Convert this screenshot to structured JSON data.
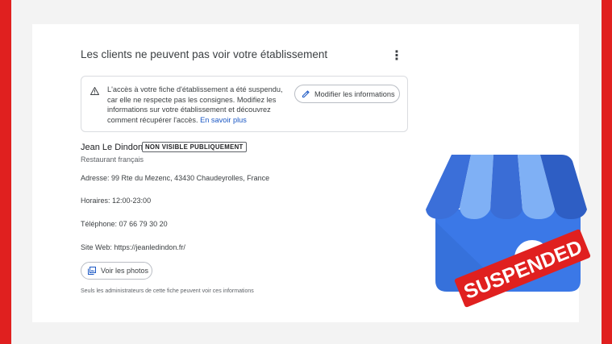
{
  "card": {
    "title": "Les clients ne peuvent pas voir votre établissement",
    "more_icon": "more-vert-icon"
  },
  "alert": {
    "icon": "warning-icon",
    "text": "L'accès à votre fiche d'établissement a été suspendu, car elle ne respecte pas les consignes. Modifiez les informations sur votre établissement et découvrez comment récupérer l'accès.",
    "link": "En savoir plus",
    "button": "Modifier les informations",
    "button_icon": "pencil-icon"
  },
  "business": {
    "name": "Jean Le Dindon",
    "badge": "NON VISIBLE PUBLIQUEMENT",
    "category": "Restaurant français",
    "address_label": "Adresse:",
    "address_value": "99 Rte du Mezenc, 43430 Chaudeyrolles, France",
    "hours_label": "Horaires:",
    "hours_value": "12:00-23:00",
    "phone_label": "Téléphone:",
    "phone_value": "07 66 79 30 20",
    "web_label": "Site Web:",
    "web_value": "https://jeanledindon.fr/"
  },
  "photos": {
    "button": "Voir les photos",
    "icon": "photo-library-icon"
  },
  "footnote": "Seuls les administrateurs de cette fiche peuvent voir ces informations",
  "logo": {
    "name": "google-my-business-logo",
    "stamp": "SUSPENDED"
  },
  "colors": {
    "frame_red": "#e0201f",
    "link_blue": "#1a57c4",
    "logo_blue": "#3b78e7",
    "stamp_red": "#e0201f"
  }
}
